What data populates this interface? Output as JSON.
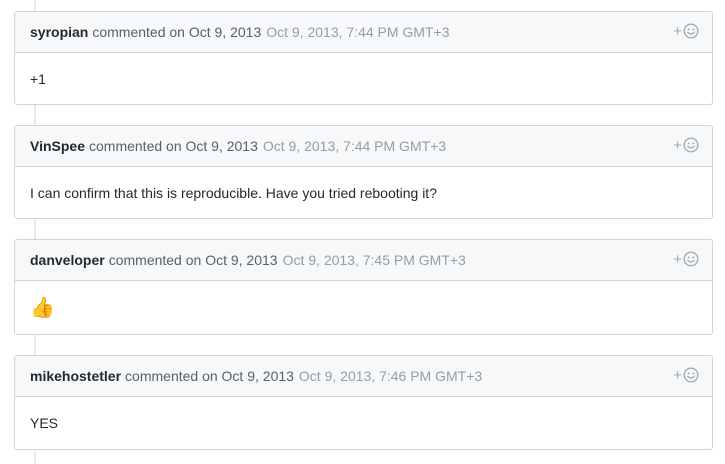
{
  "comments": [
    {
      "author": "syropian",
      "action": "commented on Oct 9, 2013",
      "timestamp": "Oct 9, 2013, 7:44 PM GMT+3",
      "body": "+1"
    },
    {
      "author": "VinSpee",
      "action": "commented on Oct 9, 2013",
      "timestamp": "Oct 9, 2013, 7:44 PM GMT+3",
      "body": "I can confirm that this is reproducible. Have you tried rebooting it?"
    },
    {
      "author": "danveloper",
      "action": "commented on Oct 9, 2013",
      "timestamp": "Oct 9, 2013, 7:45 PM GMT+3",
      "body": "👍"
    },
    {
      "author": "mikehostetler",
      "action": "commented on Oct 9, 2013",
      "timestamp": "Oct 9, 2013, 7:46 PM GMT+3",
      "body": "YES"
    }
  ],
  "reaction_button": {
    "plus": "+",
    "icon": "smiley-icon"
  },
  "colors": {
    "header_bg": "#f6f8fa",
    "border": "#d1d5da",
    "timestamp": "#959da5",
    "thumb": "#f4b400"
  }
}
